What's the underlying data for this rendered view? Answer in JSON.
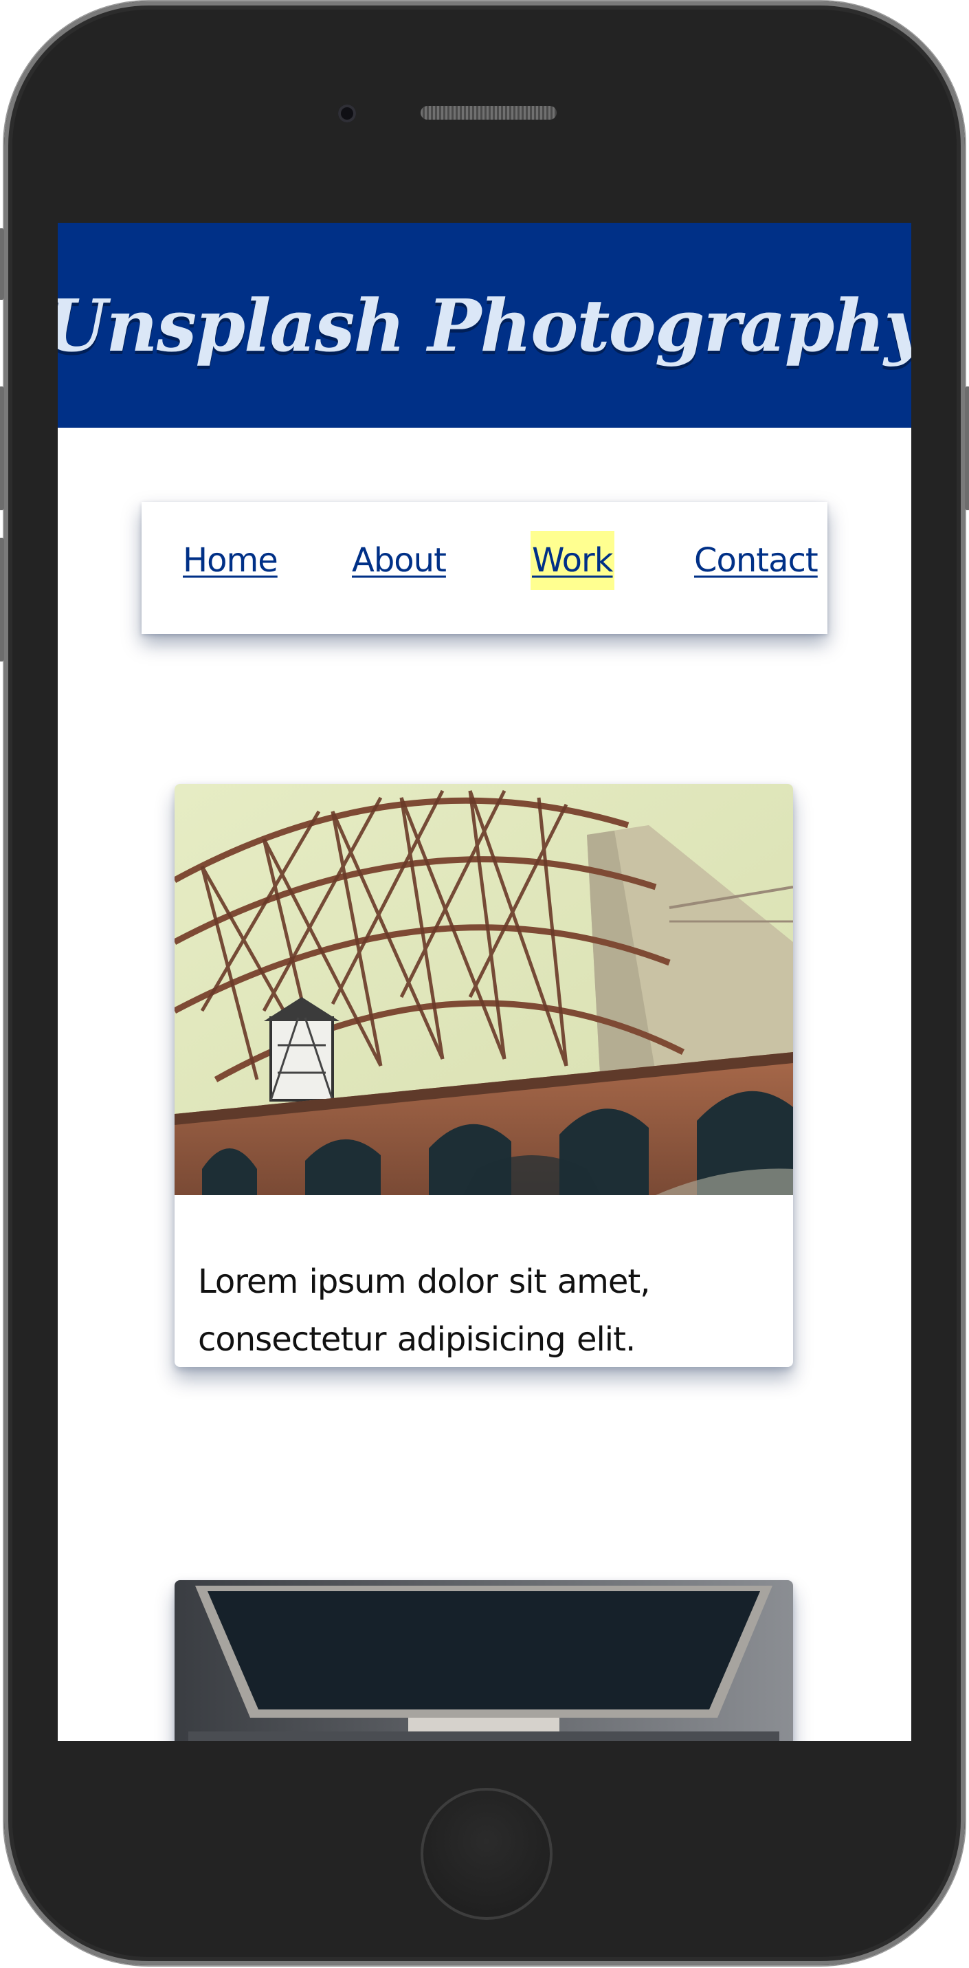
{
  "header": {
    "title": "Unsplash Photography",
    "background": "#003087",
    "title_color": "#dbe7f7"
  },
  "nav": {
    "items": [
      {
        "label": "Home",
        "active": false
      },
      {
        "label": "About",
        "active": false
      },
      {
        "label": "Work",
        "active": true
      },
      {
        "label": "Contact",
        "active": false
      }
    ],
    "link_color": "#003087",
    "active_highlight": "#ffff90"
  },
  "cards": [
    {
      "image": "bridge-arches-photo",
      "text": "Lorem ipsum dolor sit amet, consectetur adipisicing elit. Explicabo nihil enim ex voluptatibus assumenda consequatur?"
    },
    {
      "image": "desk-monitor-photo"
    }
  ]
}
